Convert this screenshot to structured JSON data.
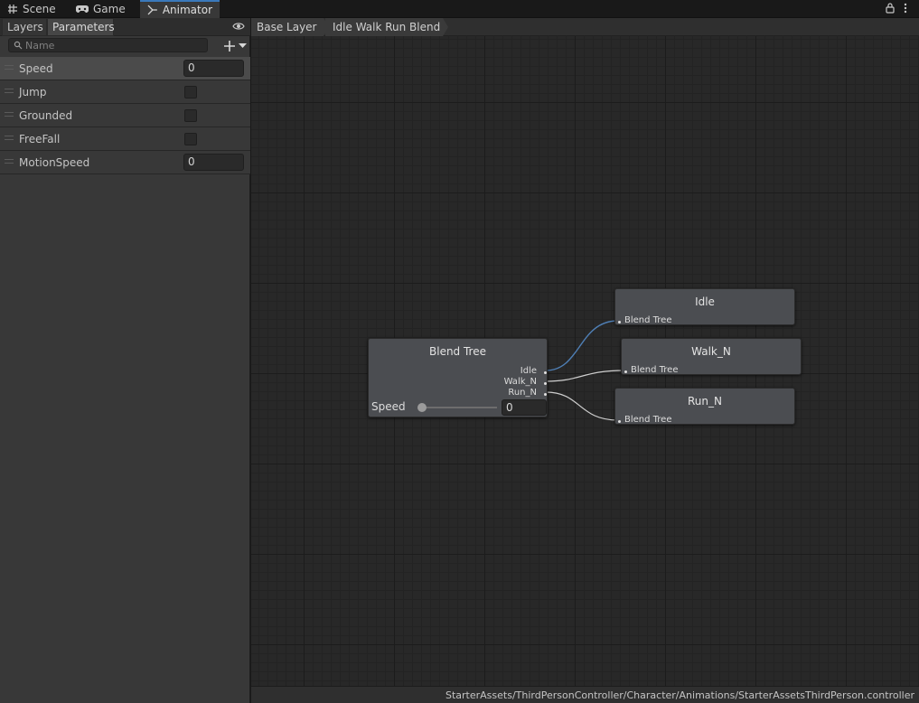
{
  "tabs": [
    {
      "label": "Scene",
      "icon": "grid-icon"
    },
    {
      "label": "Game",
      "icon": "gamepad-icon"
    },
    {
      "label": "Animator",
      "icon": "animator-icon"
    }
  ],
  "window_icons": [
    "lock-icon",
    "more-icon"
  ],
  "left_panel": {
    "tabs": [
      {
        "label": "Layers"
      },
      {
        "label": "Parameters"
      }
    ],
    "search_placeholder": "Name",
    "parameters": [
      {
        "name": "Speed",
        "type": "float",
        "value": "0"
      },
      {
        "name": "Jump",
        "type": "bool",
        "value": false
      },
      {
        "name": "Grounded",
        "type": "bool",
        "value": false
      },
      {
        "name": "FreeFall",
        "type": "bool",
        "value": false
      },
      {
        "name": "MotionSpeed",
        "type": "float",
        "value": "0"
      }
    ]
  },
  "breadcrumb": [
    "Base Layer",
    "Idle Walk Run Blend"
  ],
  "blend_tree": {
    "title": "Blend Tree",
    "outputs": [
      "Idle",
      "Walk_N",
      "Run_N"
    ],
    "parameter_label": "Speed",
    "parameter_value": "0"
  },
  "motion_nodes": [
    {
      "title": "Idle",
      "port": "Blend Tree"
    },
    {
      "title": "Walk_N",
      "port": "Blend Tree"
    },
    {
      "title": "Run_N",
      "port": "Blend Tree"
    }
  ],
  "colors": {
    "active_wire": "#4f7fb5",
    "wire": "#cfcfcf",
    "active_tab": "#3a79bb"
  },
  "status_path": "StarterAssets/ThirdPersonController/Character/Animations/StarterAssetsThirdPerson.controller"
}
